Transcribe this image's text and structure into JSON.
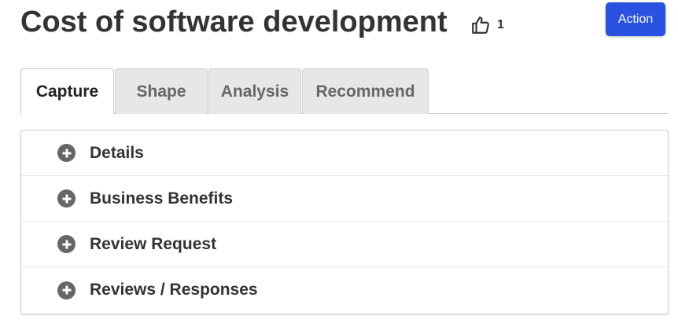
{
  "header": {
    "title": "Cost of software development",
    "like_count": "1",
    "action_label": "Action"
  },
  "colors": {
    "action_button": "#2a52e0",
    "text_dark": "#333333",
    "tab_inactive_bg": "#e7e7e7",
    "icon_gray": "#666666"
  },
  "tabs": [
    {
      "label": "Capture",
      "active": true
    },
    {
      "label": "Shape",
      "active": false
    },
    {
      "label": "Analysis",
      "active": false
    },
    {
      "label": "Recommend",
      "active": false
    }
  ],
  "sections": [
    {
      "label": "Details",
      "icon": "plus-circle-icon"
    },
    {
      "label": "Business Benefits",
      "icon": "plus-circle-icon"
    },
    {
      "label": "Review Request",
      "icon": "plus-circle-icon"
    },
    {
      "label": "Reviews / Responses",
      "icon": "plus-circle-icon"
    }
  ]
}
